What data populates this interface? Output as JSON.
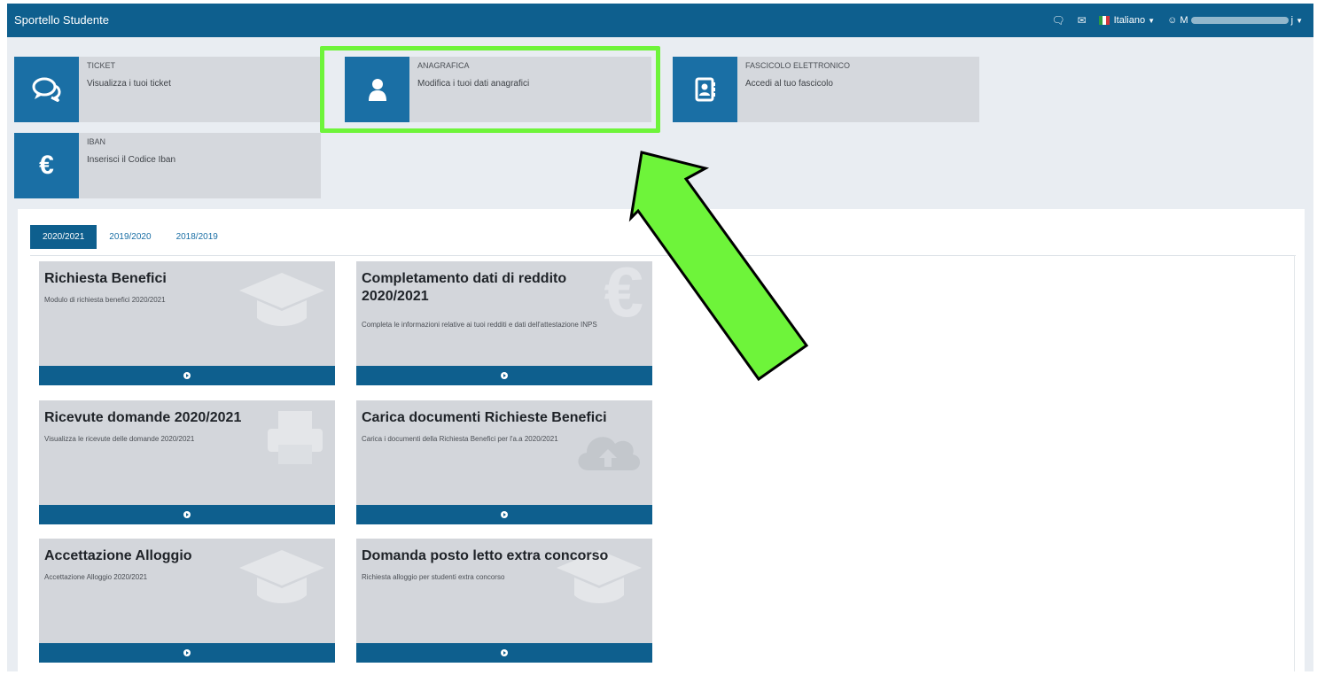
{
  "navbar": {
    "title": "Sportello Studente",
    "language": "Italiano",
    "user_label": "M",
    "user_suffix": "j",
    "icons": [
      "chat-icon",
      "mail-icon",
      "user-icon"
    ]
  },
  "tiles": [
    {
      "title": "TICKET",
      "subtitle": "Visualizza i tuoi ticket",
      "icon": "comments-icon"
    },
    {
      "title": "ANAGRAFICA",
      "subtitle": "Modifica i tuoi dati anagrafici",
      "icon": "user-icon"
    },
    {
      "title": "FASCICOLO ELETTRONICO",
      "subtitle": "Accedi al tuo fascicolo",
      "icon": "address-book-icon"
    },
    {
      "title": "IBAN",
      "subtitle": "Inserisci il Codice Iban",
      "icon": "euro-icon"
    }
  ],
  "tabs": [
    "2020/2021",
    "2019/2020",
    "2018/2019"
  ],
  "active_tab": "2020/2021",
  "cards": [
    {
      "title": "Richiesta Benefici",
      "desc": "Modulo di richiesta benefici 2020/2021",
      "icon": "graduation-cap-icon"
    },
    {
      "title": "Completamento dati di reddito 2020/2021",
      "desc": "Completa le informazioni relative ai tuoi redditi e dati dell'attestazione INPS",
      "icon": "euro-icon"
    },
    {
      "title": "Ricevute domande 2020/2021",
      "desc": "Visualizza le ricevute delle domande 2020/2021",
      "icon": "print-icon"
    },
    {
      "title": "Carica documenti Richieste Benefici",
      "desc": "Carica i documenti della Richiesta Benefici per l'a.a 2020/2021",
      "icon": "cloud-upload-icon"
    },
    {
      "title": "Accettazione Alloggio",
      "desc": "Accettazione Alloggio 2020/2021",
      "icon": "graduation-cap-icon"
    },
    {
      "title": "Domanda posto letto extra concorso",
      "desc": "Richiesta alloggio per studenti extra concorso",
      "icon": "graduation-cap-icon"
    }
  ],
  "colors": {
    "navbar": "#0e5f8e",
    "accent": "#1a6fa5",
    "highlight": "#6ef43a",
    "arrow": "#6ef43a"
  }
}
